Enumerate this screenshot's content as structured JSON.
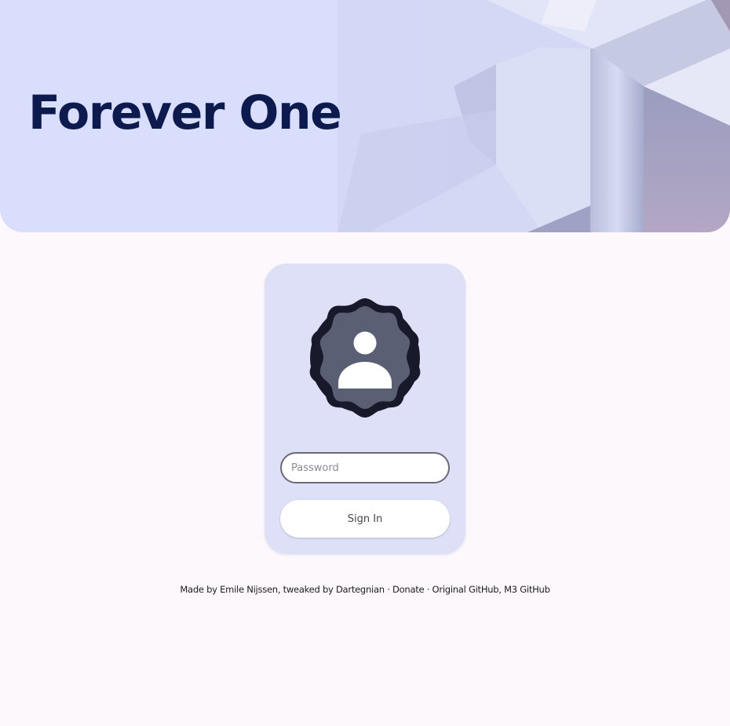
{
  "hero": {
    "title": "Forever One"
  },
  "login": {
    "avatar_icon": "person-icon",
    "password_placeholder": "Password",
    "signin_label": "Sign In"
  },
  "footer": {
    "made_by": "Made by ",
    "author": "Emile Nijssen",
    "tweaked_by": ", tweaked by ",
    "tweaker": "Dartegnian",
    "sep1": " · ",
    "donate": "Donate",
    "sep2": " · ",
    "original_github": "Original GitHub",
    "comma": ", ",
    "m3_github": "M3 GitHub"
  },
  "colors": {
    "hero_background": "#d9defc",
    "title": "#0d1a4d",
    "page_background": "#fcf8fc",
    "card_background": "#dde0f6",
    "avatar_badge_outer": "#181a2b",
    "avatar_badge_inner": "#5b5f74"
  }
}
